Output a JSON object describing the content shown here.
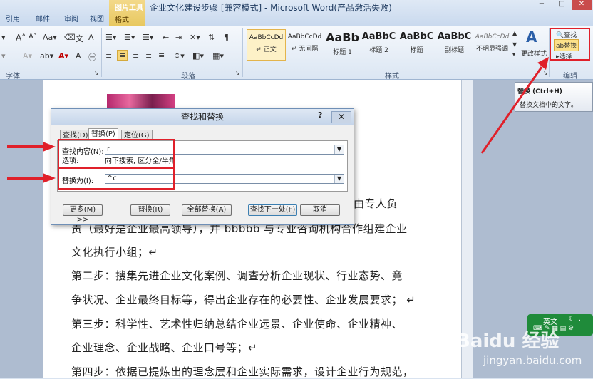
{
  "window": {
    "title": "企业文化建设步骤 [兼容模式] - Microsoft Word(产品激活失败)",
    "controls": [
      "−",
      "□",
      "✕"
    ]
  },
  "ribbon_tabs": [
    "引用",
    "邮件",
    "审阅",
    "视图"
  ],
  "contextual_group": {
    "label": "图片工具",
    "tab": "格式"
  },
  "ribbon": {
    "groups": {
      "font": "字体",
      "paragraph": "段落",
      "styles": "样式",
      "editing": "编辑"
    },
    "styles": [
      {
        "sample": "AaBbCcDd",
        "name": "↵ 正文"
      },
      {
        "sample": "AaBbCcDd",
        "name": "↵ 无间隔"
      },
      {
        "sample": "AaBb",
        "name": "标题 1"
      },
      {
        "sample": "AaBbC",
        "name": "标题 2"
      },
      {
        "sample": "AaBbC",
        "name": "标题"
      },
      {
        "sample": "AaBbC",
        "name": "副标题"
      },
      {
        "sample": "AaBbCcDd",
        "name": "不明显强调"
      }
    ],
    "change_styles": "更改样式",
    "editing": {
      "find": "查找",
      "replace": "替换",
      "select": "选择"
    }
  },
  "tooltip": {
    "title": "替换 (Ctrl+H)",
    "body": "替换文档中的文字。"
  },
  "document": {
    "lines": [
      "由专人负",
      "责（最好是企业最高领导），并 bbbbb 与专业咨询机构合作组建企业",
      "文化执行小组；↵",
      "第二步：搜集先进企业文化案例、调查分析企业现状、行业态势、竞",
      "争状况、企业最终目标等，得出企业存在的必要性、企业发展要求；  ↵",
      "第三步：科学性、艺术性归纳总结企业远景、企业使命、企业精神、",
      "企业理念、企业战略、企业口号等；↵",
      "第四步：依据已提炼出的理念层和企业实际需求，设计企业行为规范，"
    ]
  },
  "dialog": {
    "title": "查找和替换",
    "help": "?",
    "tabs": [
      "查找(D)",
      "替换(P)",
      "定位(G)"
    ],
    "find_label": "查找内容(N):",
    "find_value": "r",
    "options_label": "选项:",
    "options_value": "向下搜索, 区分全/半角",
    "replace_label": "替换为(I):",
    "replace_value": "^c",
    "buttons": {
      "more": "更多(M) >>",
      "replace": "替换(R)",
      "replace_all": "全部替换(A)",
      "find_next": "查找下一处(F)",
      "cancel": "取消"
    }
  },
  "ime": {
    "lang": "英文"
  },
  "watermark": {
    "text": "Baidu 经验",
    "url": "jingyan.baidu.com"
  },
  "colors": {
    "accent": "#e0202a",
    "ribbon": "#dbe6f3",
    "ime": "#1f8b3a"
  }
}
